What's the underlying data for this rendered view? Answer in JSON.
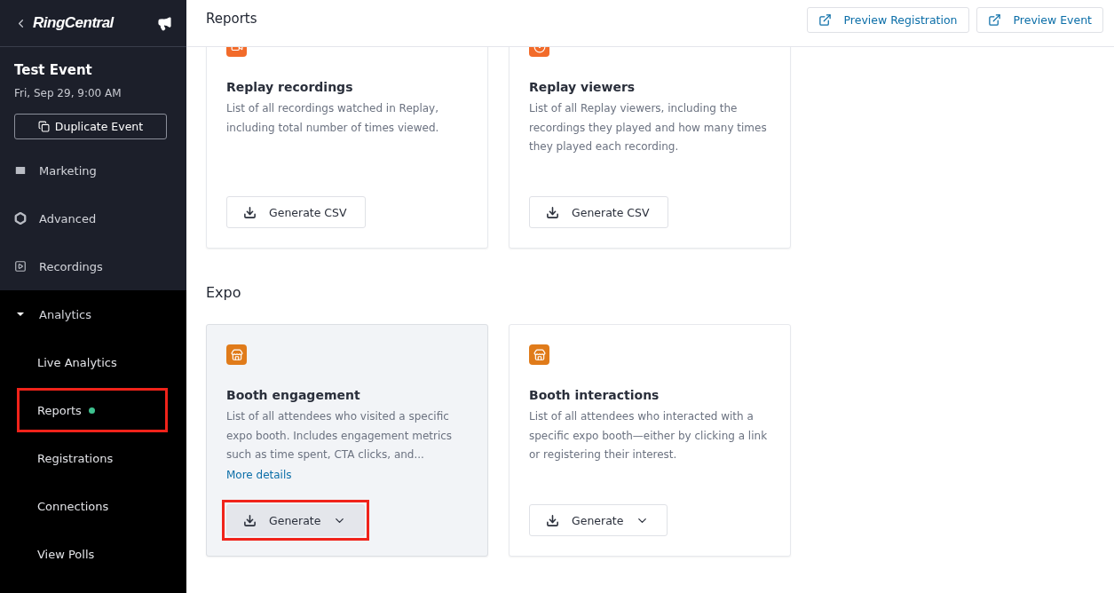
{
  "sidebar": {
    "logo": "RingCentral",
    "event_title": "Test Event",
    "event_date": "Fri, Sep 29, 9:00 AM",
    "duplicate_button": "Duplicate Event",
    "items": [
      {
        "label": "Marketing"
      },
      {
        "label": "Advanced"
      },
      {
        "label": "Recordings"
      },
      {
        "label": "Analytics",
        "expanded": true,
        "children": [
          {
            "label": "Live Analytics",
            "dot": false,
            "annotated": false
          },
          {
            "label": "Reports",
            "dot": true,
            "annotated": true
          },
          {
            "label": "Registrations",
            "dot": false,
            "annotated": false
          },
          {
            "label": "Connections",
            "dot": false,
            "annotated": false
          },
          {
            "label": "View Polls",
            "dot": false,
            "annotated": false
          }
        ]
      }
    ]
  },
  "header": {
    "title": "Reports",
    "buttons": [
      "Preview Registration",
      "Preview Event"
    ]
  },
  "sections": [
    {
      "cards": [
        {
          "kind": "recording",
          "title": "Replay recordings",
          "description": "List of all recordings watched in Replay, including total number of times viewed.",
          "hovered": false,
          "button": {
            "label": "Generate CSV",
            "dropdown": false,
            "hovered": false,
            "annotated": false
          }
        },
        {
          "kind": "viewer",
          "title": "Replay viewers",
          "description": "List of all Replay viewers, including the recordings they played and how many times they played each recording.",
          "hovered": false,
          "button": {
            "label": "Generate CSV",
            "dropdown": false,
            "hovered": false,
            "annotated": false
          }
        }
      ]
    },
    {
      "heading": "Expo",
      "cards": [
        {
          "kind": "booth",
          "title": "Booth engagement",
          "description": "List of all attendees who visited a specific expo booth. Includes engagement metrics such as time spent, CTA clicks, and...",
          "link": "More details",
          "hovered": true,
          "button": {
            "label": "Generate",
            "dropdown": true,
            "hovered": true,
            "annotated": true
          }
        },
        {
          "kind": "booth",
          "title": "Booth interactions",
          "description": "List of all attendees who interacted with a specific expo booth—either by clicking a link or registering their interest.",
          "hovered": false,
          "button": {
            "label": "Generate",
            "dropdown": true,
            "hovered": false,
            "annotated": false
          }
        }
      ]
    }
  ]
}
